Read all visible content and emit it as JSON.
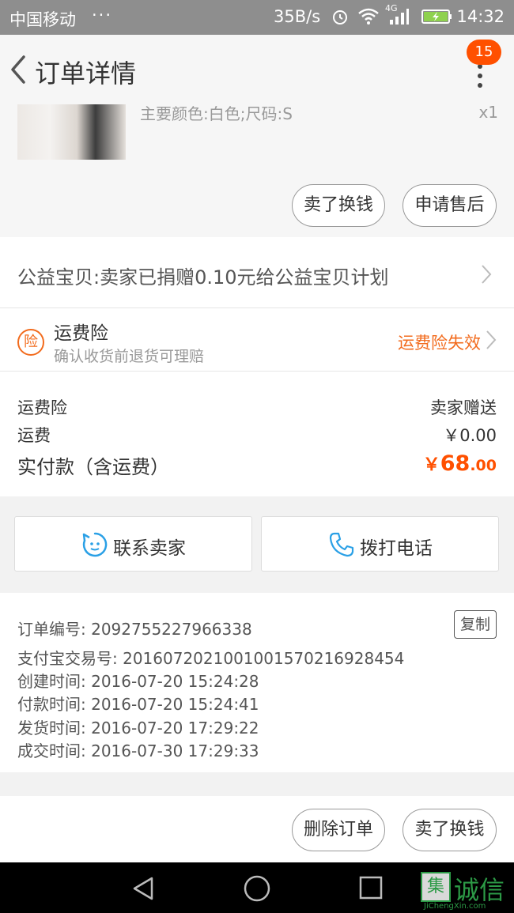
{
  "status_bar": {
    "carrier": "中国移动",
    "dots": "···",
    "speed": "35B/s",
    "network": "4G",
    "time": "14:32",
    "icons": [
      "alarm-icon",
      "wifi-icon",
      "signal-icon",
      "battery-charging-icon"
    ]
  },
  "header": {
    "title": "订单详情",
    "badge_count": "15",
    "icons": [
      "back-arrow-icon",
      "more-vertical-icon"
    ]
  },
  "product": {
    "sku": "主要颜色:白色;尺码:S",
    "qty": "x1",
    "buttons": {
      "resell": "卖了换钱",
      "after_sale": "申请售后"
    }
  },
  "charity": {
    "text": "公益宝贝:卖家已捐赠0.10元给公益宝贝计划"
  },
  "insurance": {
    "icon_text": "险",
    "title": "运费险",
    "subtitle": "确认收货前退货可理赔",
    "status": "运费险失效"
  },
  "fees": {
    "rows": [
      {
        "label": "运费险",
        "value": "卖家赠送"
      },
      {
        "label": "运费",
        "value": "￥0.00"
      }
    ],
    "total_label": "实付款（含运费）",
    "total_currency": "￥",
    "total_int": "68",
    "total_dec": ".00"
  },
  "contact": {
    "seller": "联系卖家",
    "phone": "拨打电话"
  },
  "order_info": {
    "copy_label": "复制",
    "lines": [
      "订单编号: 2092755227966338",
      "支付宝交易号: 2016072021001001570216928454",
      "创建时间: 2016-07-20 15:24:28",
      "付款时间: 2016-07-20 15:24:41",
      "发货时间: 2016-07-20 17:29:22",
      "成交时间: 2016-07-30 17:29:33"
    ]
  },
  "footer_actions": {
    "delete": "删除订单",
    "resell": "卖了换钱"
  },
  "watermark": {
    "logo_char": "集",
    "name": "诚信",
    "url": "JiChengXin.com"
  },
  "colors": {
    "accent": "#ff5000",
    "insurance": "#f26b1d",
    "contact_icon": "#2aa0e6",
    "watermark": "#2c9a46"
  }
}
